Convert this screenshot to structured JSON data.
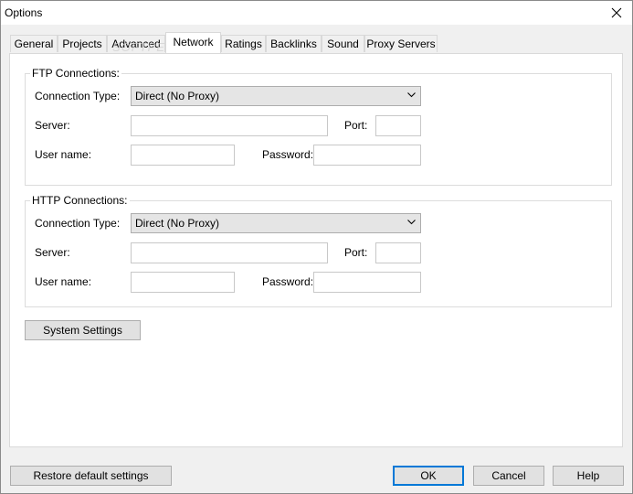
{
  "window": {
    "title": "Options"
  },
  "tabs": [
    "General",
    "Projects",
    "Advanced",
    "Network",
    "Ratings",
    "Backlinks",
    "Sound",
    "Proxy Servers"
  ],
  "active_tab": "Network",
  "watermark": "SOFTPEDIA",
  "ftp": {
    "legend": "FTP Connections:",
    "connection_type_label": "Connection Type:",
    "connection_type_value": "Direct (No Proxy)",
    "server_label": "Server:",
    "server_value": "",
    "port_label": "Port:",
    "port_value": "",
    "username_label": "User name:",
    "username_value": "",
    "password_label": "Password:",
    "password_value": ""
  },
  "http": {
    "legend": "HTTP Connections:",
    "connection_type_label": "Connection Type:",
    "connection_type_value": "Direct (No Proxy)",
    "server_label": "Server:",
    "server_value": "",
    "port_label": "Port:",
    "port_value": "",
    "username_label": "User name:",
    "username_value": "",
    "password_label": "Password:",
    "password_value": ""
  },
  "buttons": {
    "system_settings": "System Settings",
    "restore_defaults": "Restore default settings",
    "ok": "OK",
    "cancel": "Cancel",
    "help": "Help"
  },
  "colors": {
    "accent": "#0078d7",
    "window_bg": "#f0f0f0",
    "panel_bg": "#ffffff"
  }
}
